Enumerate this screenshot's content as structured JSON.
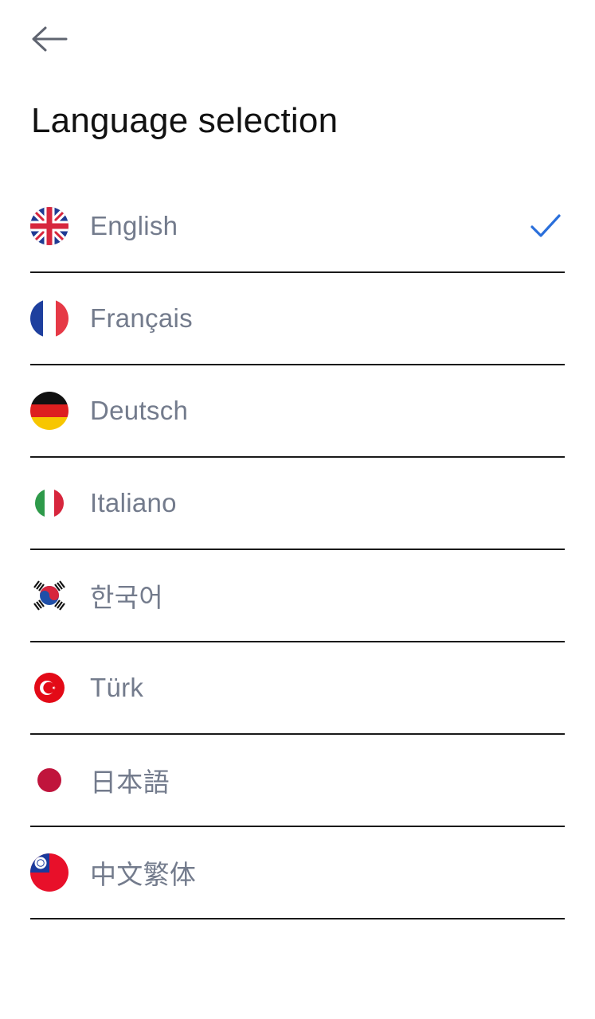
{
  "header": {
    "back_icon": "arrow-left-icon",
    "title": "Language selection"
  },
  "languages": [
    {
      "label": "English",
      "flag": "uk-flag-icon",
      "selected": true
    },
    {
      "label": "Français",
      "flag": "france-flag-icon",
      "selected": false
    },
    {
      "label": "Deutsch",
      "flag": "germany-flag-icon",
      "selected": false
    },
    {
      "label": "Italiano",
      "flag": "italy-flag-icon",
      "selected": false
    },
    {
      "label": "한국어",
      "flag": "korea-flag-icon",
      "selected": false
    },
    {
      "label": "Türk",
      "flag": "turkey-flag-icon",
      "selected": false
    },
    {
      "label": "日本語",
      "flag": "japan-flag-icon",
      "selected": false
    },
    {
      "label": "中文繁体",
      "flag": "taiwan-flag-icon",
      "selected": false
    }
  ],
  "colors": {
    "accent": "#2a6fdb",
    "label_text": "#737b8c",
    "title_text": "#111111",
    "divider": "#1a1a1a"
  }
}
